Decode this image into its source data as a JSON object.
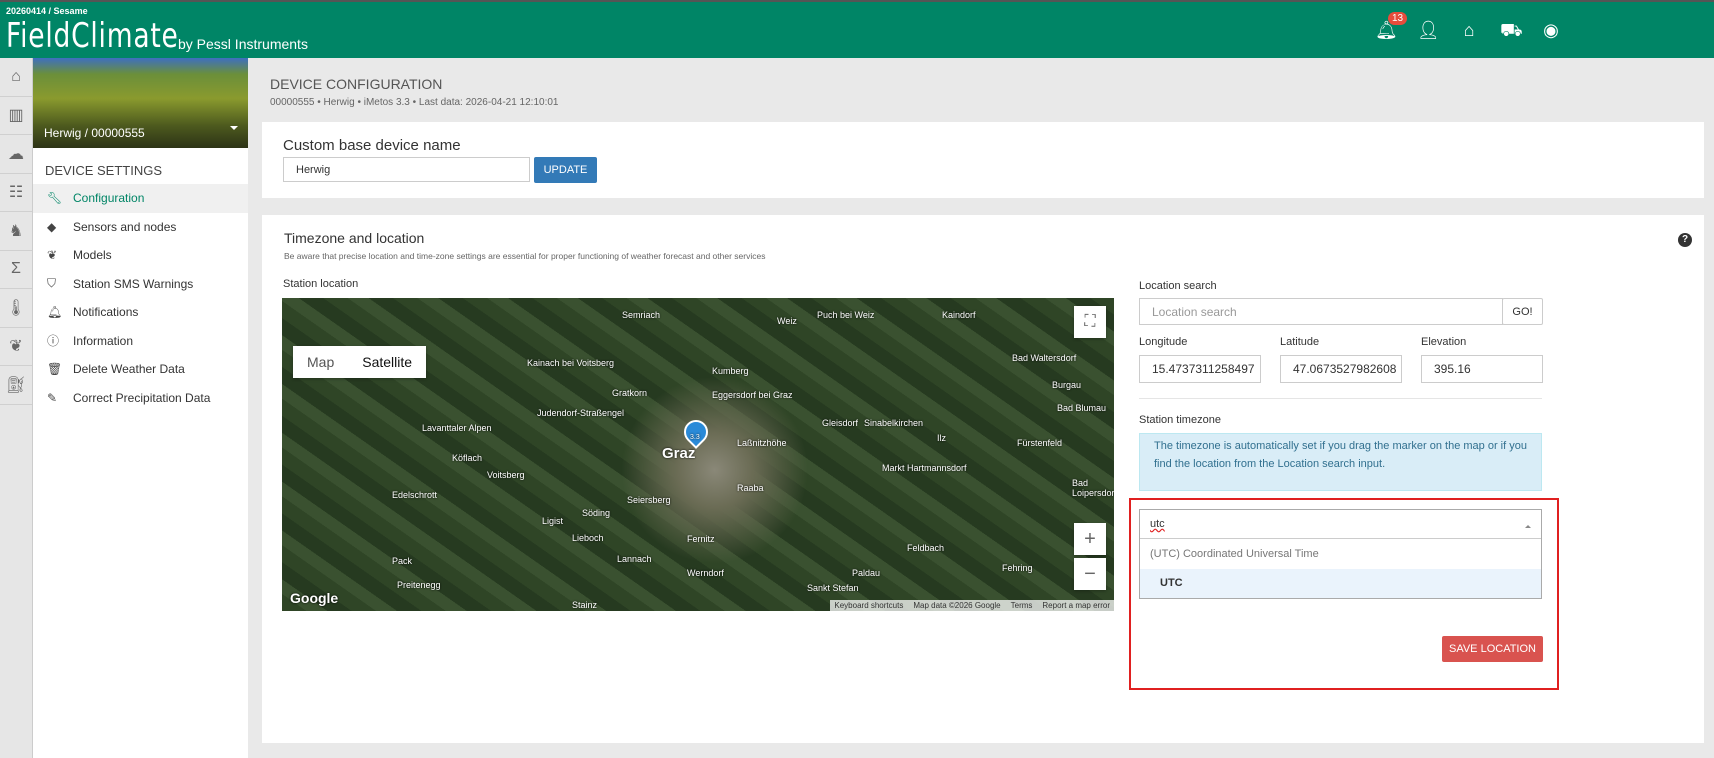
{
  "header": {
    "build": "20260414 / Sesame",
    "logo": "FieldClimate",
    "logo_by": "by Pessl Instruments",
    "notification_count": "13"
  },
  "sidebar": {
    "device": "Herwig / 00000555",
    "section": "DEVICE SETTINGS",
    "items": [
      {
        "label": "Configuration",
        "icon": "wrench-icon"
      },
      {
        "label": "Sensors and nodes",
        "icon": "tag-icon"
      },
      {
        "label": "Models",
        "icon": "leaf-icon"
      },
      {
        "label": "Station SMS Warnings",
        "icon": "shield-icon"
      },
      {
        "label": "Notifications",
        "icon": "bell-icon"
      },
      {
        "label": "Information",
        "icon": "info-icon"
      },
      {
        "label": "Delete Weather Data",
        "icon": "trash-icon"
      },
      {
        "label": "Correct Precipitation Data",
        "icon": "pencil-icon"
      }
    ]
  },
  "page": {
    "title": "DEVICE CONFIGURATION",
    "subtitle": "00000555 • Herwig • iMetos 3.3 • Last data: 2026-04-21 12:10:01"
  },
  "name_card": {
    "title": "Custom base device name",
    "value": "Herwig",
    "update": "UPDATE"
  },
  "location": {
    "title": "Timezone and location",
    "note": "Be aware that precise location and time-zone settings are essential for proper functioning of weather forecast and other services",
    "station_location": "Station location",
    "search_label": "Location search",
    "search_placeholder": "Location search",
    "go": "GO!",
    "longitude_label": "Longitude",
    "longitude": "15.4737311258497",
    "latitude_label": "Latitude",
    "latitude": "47.0673527982608",
    "elevation_label": "Elevation",
    "elevation": "395.16",
    "timezone_label": "Station timezone",
    "info": "The timezone is automatically set if you drag the marker on the map or if you find the location from the Location search input.",
    "tz_query": "utc",
    "tz_group": "(UTC) Coordinated Universal Time",
    "tz_option": "UTC",
    "save": "SAVE LOCATION"
  },
  "map": {
    "map_tab": "Map",
    "satellite_tab": "Satellite",
    "marker_label": "3.3",
    "google": "Google",
    "attribution": [
      "Keyboard shortcuts",
      "Map data ©2026 Google",
      "Terms",
      "Report a map error"
    ],
    "places": [
      "Semriach",
      "Weiz",
      "Puch bei Weiz",
      "Kaindorf",
      "Bad Waltersdorf",
      "Burgau",
      "Bad Blumau",
      "Kumberg",
      "Eggersdorf bei Graz",
      "Gleisdorf",
      "Sinabelkirchen",
      "Ilz",
      "Fürstenfeld",
      "Gratkorn",
      "Judendorf-Straßengel",
      "Graz",
      "Laßnitzhöhe",
      "Markt Hartmannsdorf",
      "Kainach bei Voitsberg",
      "Lavanttaler Alpen",
      "Köflach",
      "Voitsberg",
      "Edelschrott",
      "Seiersberg",
      "Raaba",
      "Bad Loipersdorf",
      "Ligist",
      "Söding",
      "Lieboch",
      "Fernitz",
      "Pack",
      "Preitenegg",
      "Lannach",
      "Werndorf",
      "Feldbach",
      "Paldau",
      "Fehring",
      "Sankt Stefan",
      "Stainz"
    ]
  }
}
